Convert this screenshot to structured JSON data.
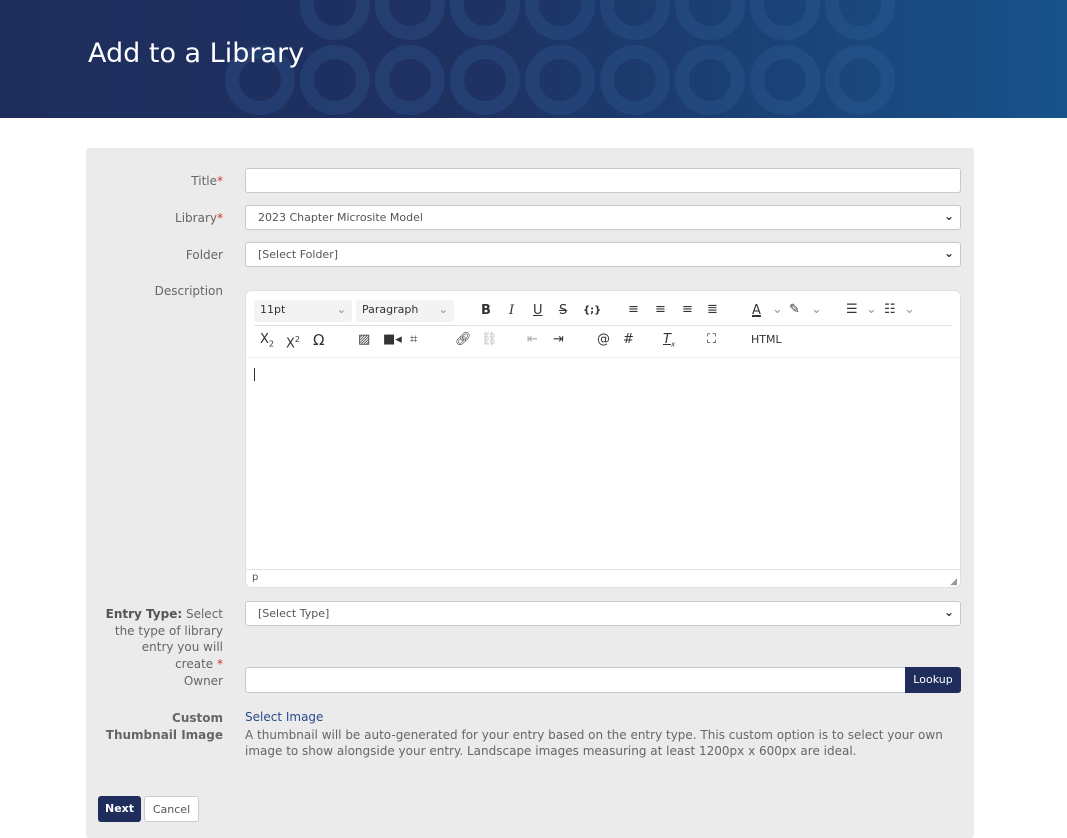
{
  "header": {
    "title": "Add to a Library"
  },
  "form": {
    "title_label": "Title",
    "title_value": "",
    "library_label": "Library",
    "library_value": "2023 Chapter Microsite Model",
    "folder_label": "Folder",
    "folder_value": "[Select Folder]",
    "description_label": "Description",
    "editor": {
      "font_size": "11pt",
      "block_format": "Paragraph",
      "html_label": "HTML",
      "status_path": "p",
      "toolbar_icons": [
        "bold-icon",
        "italic-icon",
        "underline-icon",
        "strikethrough-icon",
        "code-icon",
        "align-left-icon",
        "align-center-icon",
        "align-right-icon",
        "align-justify-icon",
        "text-color-icon",
        "highlight-icon",
        "bullet-list-icon",
        "numbered-list-icon",
        "subscript-icon",
        "superscript-icon",
        "omega-icon",
        "image-icon",
        "video-icon",
        "crop-icon",
        "link-icon",
        "unlink-icon",
        "outdent-icon",
        "indent-icon",
        "mention-icon",
        "hashtag-icon",
        "clear-format-icon",
        "fullscreen-icon"
      ]
    },
    "entry_type_label_bold": "Entry Type:",
    "entry_type_label_rest": " Select the type of library entry you will create",
    "entry_type_value": "[Select Type]",
    "owner_label": "Owner",
    "owner_value": "",
    "lookup_label": "Lookup",
    "thumbnail_label": "Custom Thumbnail Image",
    "select_image_link": "Select Image",
    "thumbnail_help": "A thumbnail will be auto-generated for your entry based on the entry type. This custom option is to select your own image to show alongside your entry. Landscape images measuring at least 1200px x 600px are ideal.",
    "required_mark": "*"
  },
  "actions": {
    "next": "Next",
    "cancel": "Cancel"
  },
  "colors": {
    "brand": "#1e2d5c",
    "required": "#d0312d"
  }
}
